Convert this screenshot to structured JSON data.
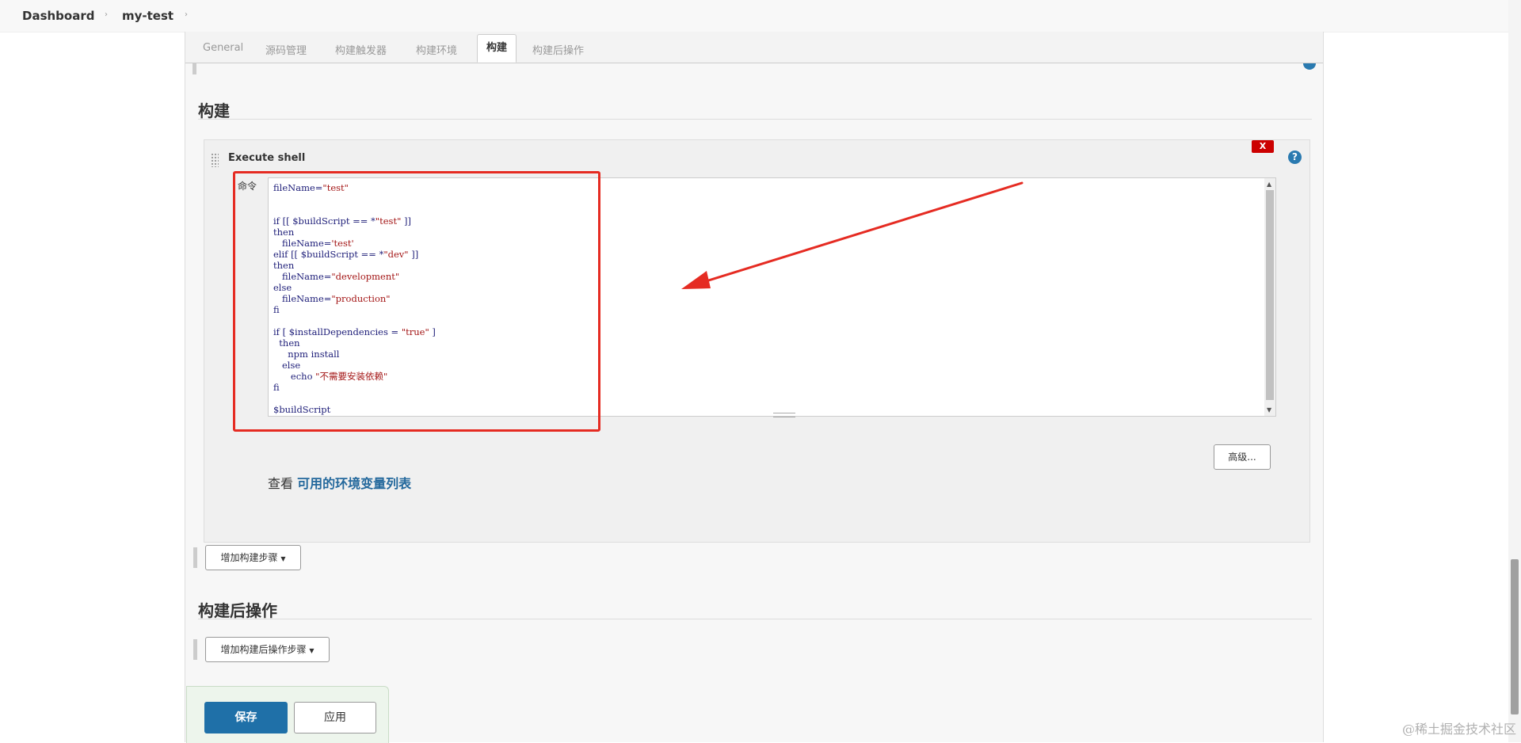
{
  "breadcrumb": {
    "items": [
      "Dashboard",
      "my-test"
    ],
    "separator": "›"
  },
  "tabs": [
    "General",
    "源码管理",
    "构建触发器",
    "构建环境",
    "构建",
    "构建后操作"
  ],
  "active_tab": "构建",
  "build_section": {
    "title": "构建",
    "step": {
      "title": "Execute shell",
      "delete_label": "X",
      "command_label": "命令",
      "help_label": "?",
      "command_lines": [
        "fileName=\"test\"",
        "",
        "",
        "if [[ $buildScript == *\"test\" ]]",
        "then",
        "   fileName='test'",
        "elif [[ $buildScript == *\"dev\" ]]",
        "then",
        "   fileName=\"development\"",
        "else",
        "   fileName=\"production\"",
        "fi",
        "",
        "if [ $installDependencies = \"true\" ]",
        "  then",
        "     npm install",
        "   else",
        "      echo \"不需要安装依赖\"",
        "fi",
        "",
        "$buildScript"
      ],
      "env_prefix": "查看",
      "env_link": "可用的环境变量列表",
      "advanced_label": "高级..."
    },
    "add_step_label": "增加构建步骤"
  },
  "post_build_section": {
    "title": "构建后操作",
    "add_step_label": "增加构建后操作步骤"
  },
  "actions": {
    "save_label": "保存",
    "apply_label": "应用"
  },
  "watermark": "@稀土掘金技术社区",
  "colors": {
    "primary_button": "#1f70a8",
    "delete_button": "#cc0000",
    "highlight_annotation": "#e52b22",
    "link": "#23689c"
  },
  "icons": [
    "drag-handle-icon",
    "help-icon",
    "dropdown-caret-icon",
    "scroll-up-icon",
    "scroll-down-icon"
  ]
}
